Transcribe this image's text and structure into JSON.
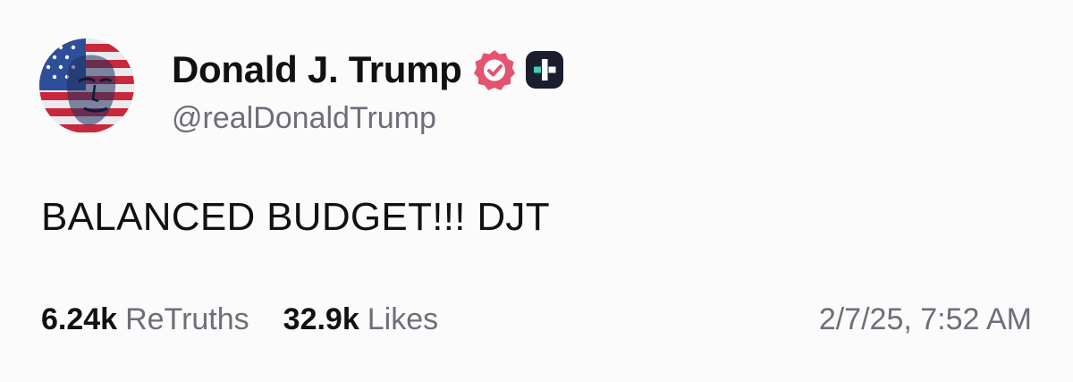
{
  "author": {
    "display_name": "Donald J. Trump",
    "handle": "@realDonaldTrump",
    "verified_badge_color": "#e4536f",
    "plus_badge_color": "#1b1e2e",
    "plus_badge_accent": "#3fd0b4",
    "avatar_icon": "avatar-flag-portrait"
  },
  "post": {
    "text": "BALANCED BUDGET!!! DJT"
  },
  "stats": {
    "retruths_count": "6.24k",
    "retruths_label": "ReTruths",
    "likes_count": "32.9k",
    "likes_label": "Likes"
  },
  "timestamp": "2/7/25, 7:52 AM"
}
